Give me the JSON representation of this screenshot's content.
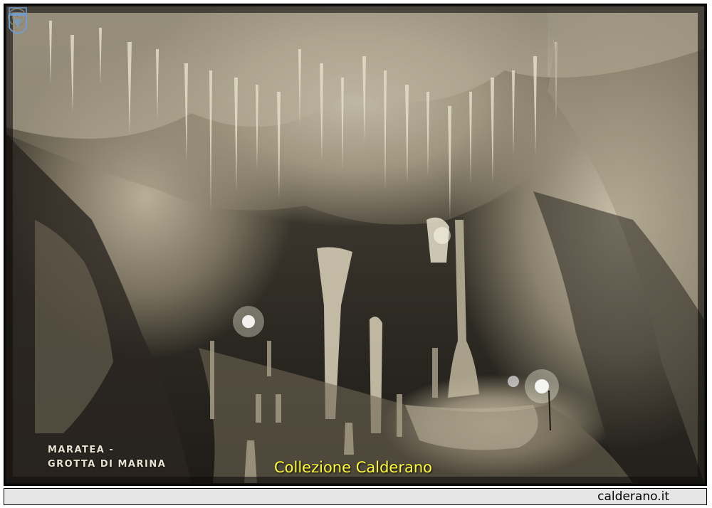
{
  "photo": {
    "caption_line1": "MARATEA -",
    "caption_line2": "GROTTA DI MARINA",
    "collection_watermark": "Collezione Calderano"
  },
  "footer": {
    "site": "calderano.it"
  },
  "colors": {
    "watermark": "#ffff33",
    "footer_bg": "#e6e6e6"
  },
  "icons": {
    "left_seal": "coat-of-arms-icon",
    "right_seal": "coat-of-arms-icon"
  }
}
